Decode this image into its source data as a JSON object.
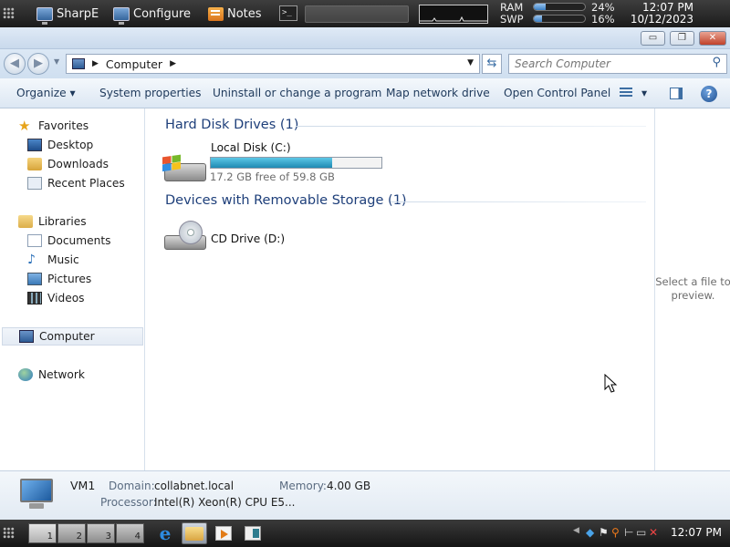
{
  "topbar": {
    "apps": [
      {
        "label": "SharpE",
        "icon": "monitor-icon"
      },
      {
        "label": "Configure",
        "icon": "monitor-icon"
      },
      {
        "label": "Notes",
        "icon": "notes-icon"
      }
    ],
    "terminal_icon": "terminal-icon",
    "ram_label": "RAM",
    "ram_percent": "24%",
    "ram_fraction": 0.24,
    "swp_label": "SWP",
    "swp_percent": "16%",
    "swp_fraction": 0.16,
    "time": "12:07 PM",
    "date": "10/12/2023"
  },
  "window": {
    "controls": {
      "minimize": "▭",
      "maximize": "❐",
      "close": "✕"
    }
  },
  "address": {
    "location": "Computer",
    "search_placeholder": "Search Computer"
  },
  "commands": {
    "organize": "Organize ▾",
    "system_properties": "System properties",
    "uninstall": "Uninstall or change a program",
    "map_drive": "Map network drive",
    "control_panel": "Open Control Panel",
    "view_menu": "▾"
  },
  "nav": {
    "favorites": "Favorites",
    "desktop": "Desktop",
    "downloads": "Downloads",
    "recent_places": "Recent Places",
    "libraries": "Libraries",
    "documents": "Documents",
    "music": "Music",
    "pictures": "Pictures",
    "videos": "Videos",
    "computer": "Computer",
    "network": "Network"
  },
  "content": {
    "hdd_group": "Hard Disk Drives (1)",
    "removable_group": "Devices with Removable Storage (1)",
    "local_disk": {
      "name": "Local Disk (C:)",
      "free_text": "17.2 GB free of 59.8 GB",
      "used_fraction": 0.712
    },
    "cd_drive": {
      "name": "CD Drive (D:)"
    }
  },
  "preview": {
    "message": "Select a file to preview."
  },
  "details": {
    "name": "VM1",
    "domain_label": "Domain:",
    "domain_value": "collabnet.local",
    "memory_label": "Memory:",
    "memory_value": "4.00 GB",
    "processor_label": "Processor:",
    "processor_value": "Intel(R) Xeon(R) CPU E5..."
  },
  "taskbar": {
    "workspaces": [
      "1",
      "2",
      "3",
      "4"
    ],
    "active_workspace": "1",
    "clock": "12:07 PM"
  }
}
